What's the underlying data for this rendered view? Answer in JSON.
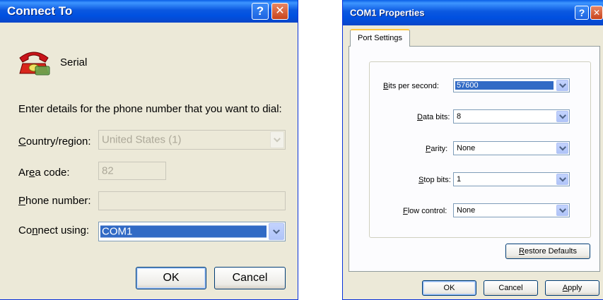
{
  "connect_to": {
    "title": "Connect To",
    "help_glyph": "?",
    "close_glyph": "✕",
    "connection_name": "Serial",
    "prompt": "Enter details for the phone number that you want to dial:",
    "country_label_pre": "",
    "country_label_key": "C",
    "country_label_post": "ountry/region:",
    "country_value": "United States (1)",
    "area_label_pre": "Ar",
    "area_label_key": "e",
    "area_label_post": "a code:",
    "area_value": "82",
    "phone_label_pre": "",
    "phone_label_key": "P",
    "phone_label_post": "hone number:",
    "phone_value": "",
    "connect_label_pre": "Co",
    "connect_label_key": "n",
    "connect_label_post": "nect using:",
    "connect_value": "COM1",
    "ok_label": "OK",
    "cancel_label": "Cancel"
  },
  "com_properties": {
    "title": "COM1 Properties",
    "help_glyph": "?",
    "close_glyph": "✕",
    "tab_label": "Port Settings",
    "bits_label_key": "B",
    "bits_label_post": "its per second:",
    "bits_value": "57600",
    "data_label_pre": "",
    "data_label_key": "D",
    "data_label_post": "ata bits:",
    "data_value": "8",
    "parity_label_key": "P",
    "parity_label_post": "arity:",
    "parity_value": "None",
    "stop_label_key": "S",
    "stop_label_post": "top bits:",
    "stop_value": "1",
    "flow_label_key": "F",
    "flow_label_post": "low control:",
    "flow_value": "None",
    "restore_key": "R",
    "restore_post": "estore Defaults",
    "ok_label": "OK",
    "cancel_label": "Cancel",
    "apply_key": "A",
    "apply_post": "pply"
  }
}
